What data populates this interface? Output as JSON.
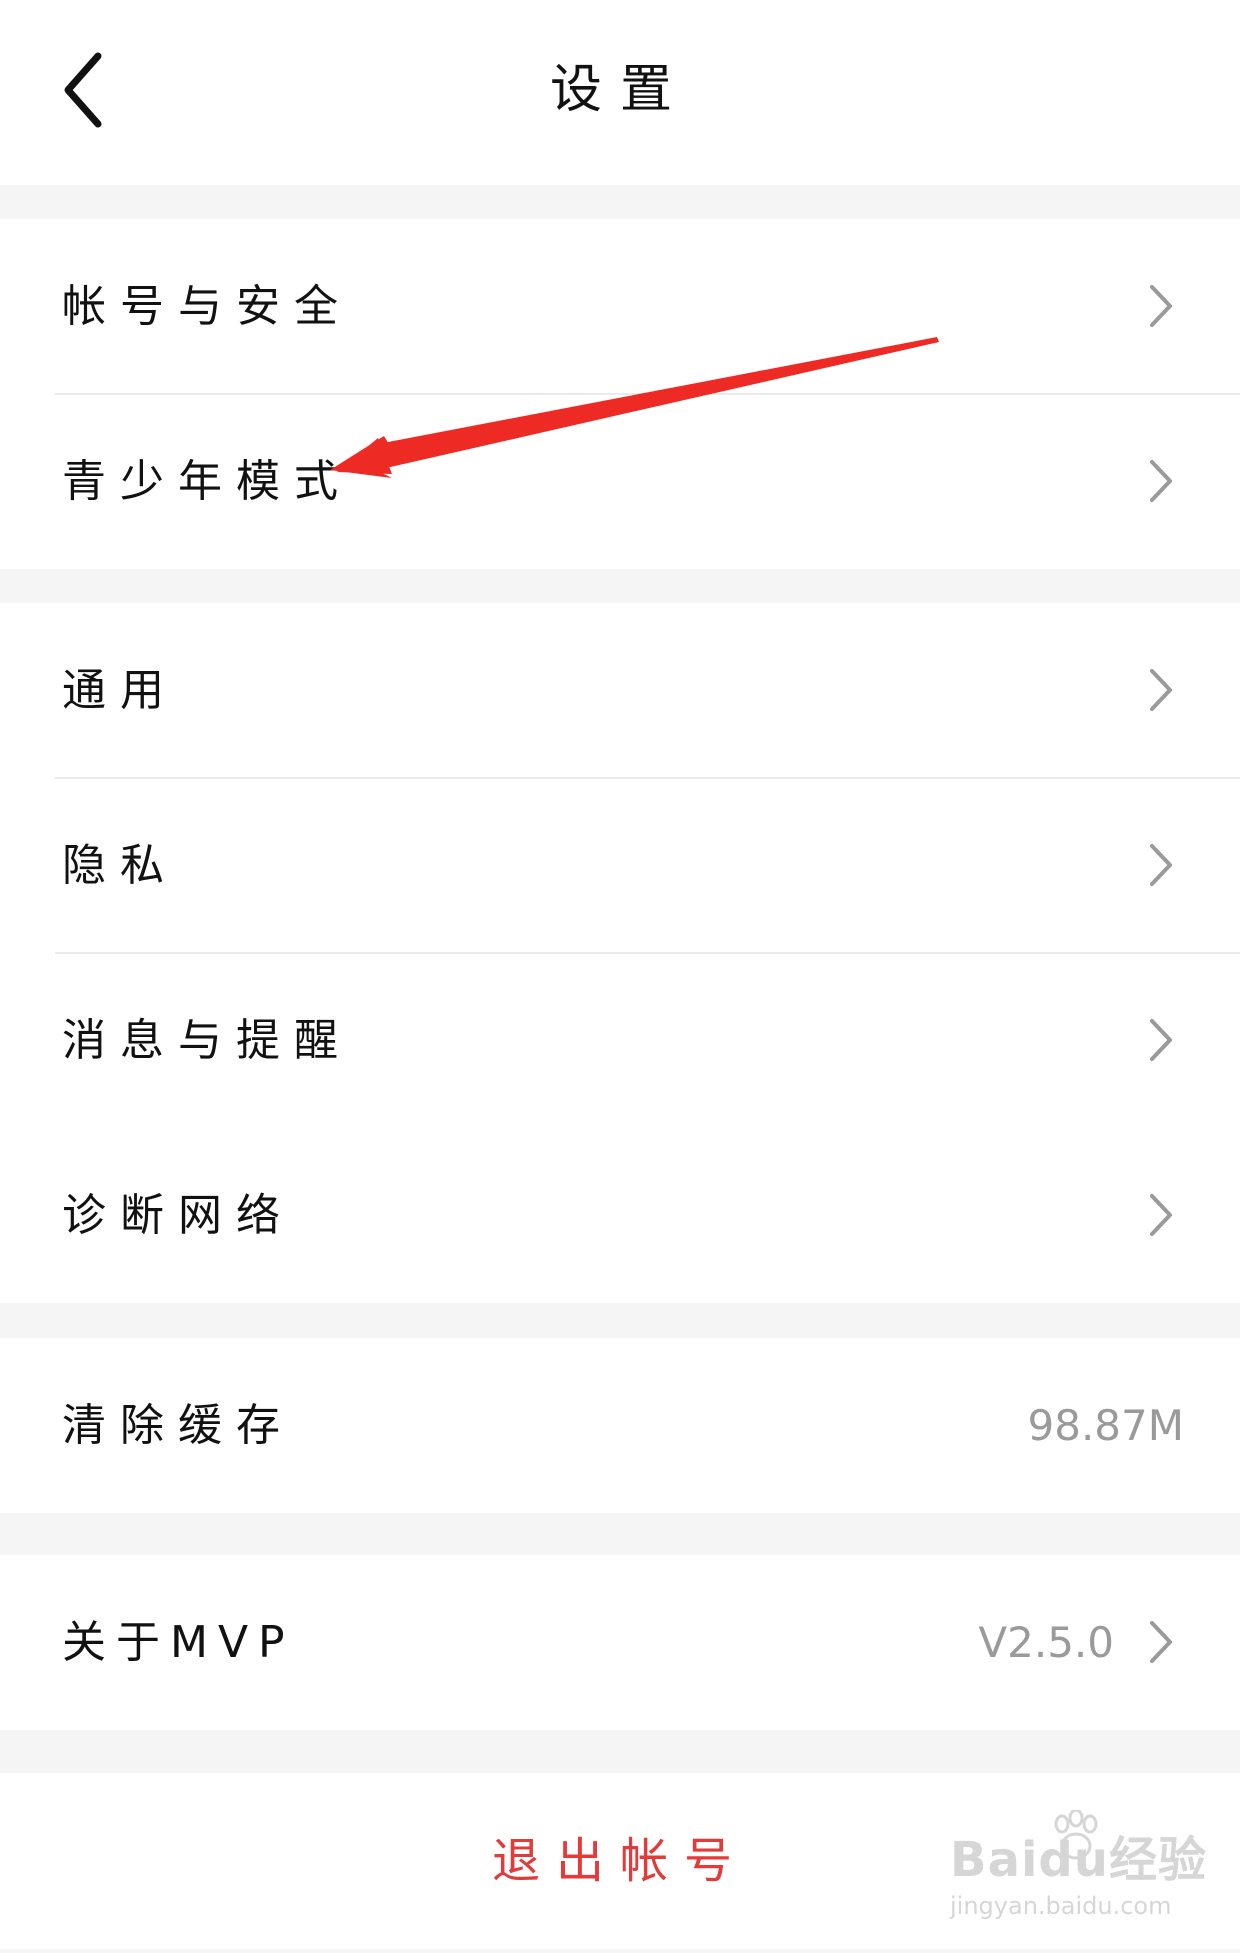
{
  "header": {
    "title": "设置",
    "back_icon": "chevron-left-icon"
  },
  "sections": {
    "account": {
      "items": [
        {
          "label": "帐号与安全",
          "icon": "chevron-right-icon"
        },
        {
          "label": "青少年模式",
          "icon": "chevron-right-icon"
        }
      ]
    },
    "general": {
      "items": [
        {
          "label": "通用",
          "icon": "chevron-right-icon"
        },
        {
          "label": "隐私",
          "icon": "chevron-right-icon"
        },
        {
          "label": "消息与提醒",
          "icon": "chevron-right-icon"
        },
        {
          "label": "诊断网络",
          "icon": "chevron-right-icon"
        }
      ]
    },
    "cache": {
      "label": "清除缓存",
      "value": "98.87M"
    },
    "about": {
      "label": "关于MVP",
      "value": "V2.5.0",
      "icon": "chevron-right-icon"
    }
  },
  "logout": {
    "label": "退出帐号"
  },
  "annotation": {
    "arrow_color": "#ee2a24",
    "icon": "red-arrow-icon"
  },
  "watermark": {
    "main": "Baidu经验",
    "sub": "jingyan.baidu.com"
  },
  "colors": {
    "background": "#f5f5f5",
    "surface": "#ffffff",
    "text": "#111111",
    "secondary_text": "#9a9a9a",
    "danger": "#e33a3a",
    "divider": "#ebebeb"
  }
}
